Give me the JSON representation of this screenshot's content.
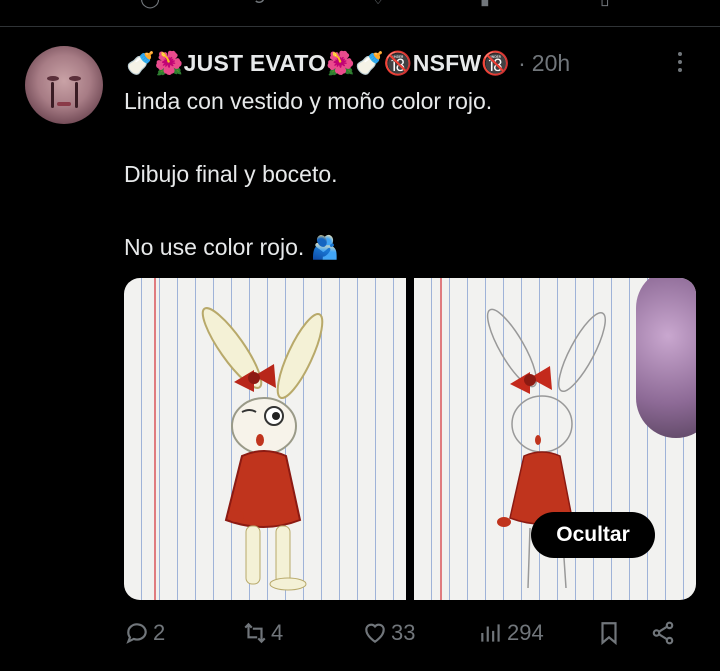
{
  "post": {
    "author": {
      "display_name": "🍼🌺JUST EVATO🌺🍼🔞NSFW🔞",
      "avatar_icon": "avatar-icon"
    },
    "separator": "·",
    "time": "20h",
    "lines": [
      "Linda con vestido y moño color rojo.",
      "Dibujo final y boceto.",
      "No use color rojo. 🫂"
    ],
    "media": {
      "hide_label": "Ocultar",
      "images": [
        "rabbit-final-drawing",
        "rabbit-sketch"
      ]
    },
    "stats": {
      "replies": "2",
      "reposts": "4",
      "likes": "33",
      "views": "294"
    }
  },
  "colors": {
    "background": "#000000",
    "text": "#e7e9ea",
    "muted": "#71767b",
    "divider": "#2f3336",
    "dress_red": "#c0341d"
  }
}
